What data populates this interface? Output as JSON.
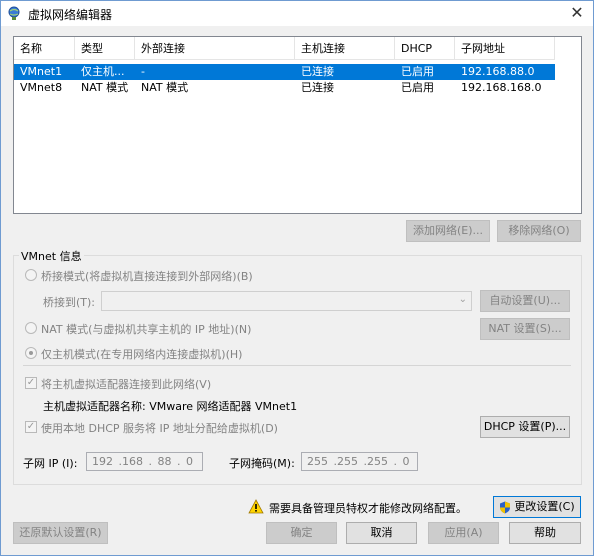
{
  "window": {
    "title": "虚拟网络编辑器",
    "close_glyph": "✕"
  },
  "table": {
    "headers": [
      "名称",
      "类型",
      "外部连接",
      "主机连接",
      "DHCP",
      "子网地址"
    ],
    "rows": [
      {
        "name": "VMnet1",
        "type": "仅主机...",
        "external": "-",
        "host": "已连接",
        "dhcp": "已启用",
        "subnet": "192.168.88.0",
        "selected": true
      },
      {
        "name": "VMnet8",
        "type": "NAT 模式",
        "external": "NAT 模式",
        "host": "已连接",
        "dhcp": "已启用",
        "subnet": "192.168.168.0",
        "selected": false
      }
    ]
  },
  "buttons": {
    "add_network": "添加网络(E)...",
    "remove_network": "移除网络(O)",
    "auto_settings": "自动设置(U)...",
    "nat_settings": "NAT 设置(S)...",
    "dhcp_settings": "DHCP 设置(P)...",
    "change_settings": "更改设置(C)",
    "restore_defaults": "还原默认设置(R)",
    "ok": "确定",
    "cancel": "取消",
    "apply": "应用(A)",
    "help": "帮助"
  },
  "vmnet_info": {
    "group_label": "VMnet 信息",
    "bridged_label": "桥接模式(将虚拟机直接连接到外部网络)(B)",
    "bridged_to_label": "桥接到(T):",
    "nat_label": "NAT 模式(与虚拟机共享主机的 IP 地址)(N)",
    "host_only_label": "仅主机模式(在专用网络内连接虚拟机)(H)",
    "connect_adapter_label": "将主机虚拟适配器连接到此网络(V)",
    "adapter_name_label": "主机虚拟适配器名称: VMware 网络适配器 VMnet1",
    "use_dhcp_label": "使用本地 DHCP 服务将 IP 地址分配给虚拟机(D)",
    "subnet_ip_label": "子网 IP (I):",
    "subnet_ip_value": "192 .168 . 88 . 0",
    "subnet_mask_label": "子网掩码(M):",
    "subnet_mask_value": "255 .255 .255 . 0"
  },
  "admin_warning": "需要具备管理员特权才能修改网络配置。",
  "colors": {
    "selection": "#0078d7",
    "accent": "#0078d7"
  }
}
